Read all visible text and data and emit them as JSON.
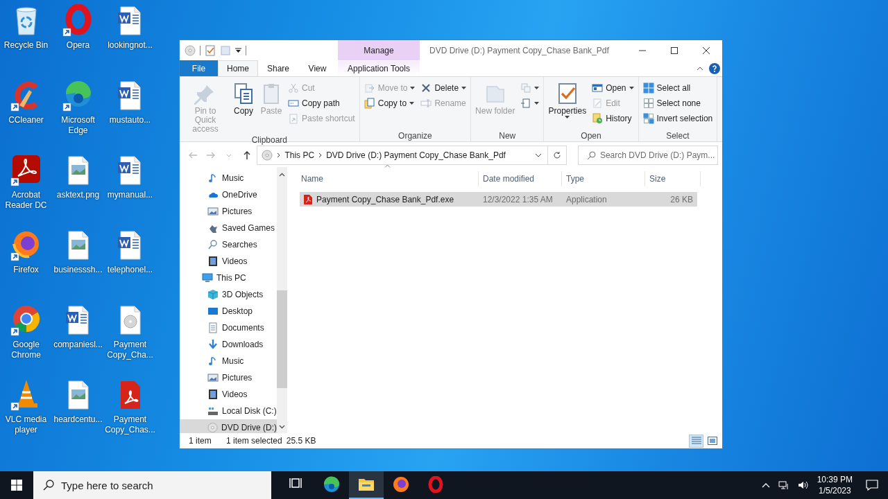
{
  "desktop_icons": [
    {
      "label": "Recycle Bin",
      "kind": "recycle",
      "shortcut": false
    },
    {
      "label": "CCleaner",
      "kind": "ccleaner",
      "shortcut": true
    },
    {
      "label": "Acrobat Reader DC",
      "kind": "acrobat",
      "shortcut": true
    },
    {
      "label": "Firefox",
      "kind": "firefox",
      "shortcut": true
    },
    {
      "label": "Google Chrome",
      "kind": "chrome",
      "shortcut": true
    },
    {
      "label": "VLC media player",
      "kind": "vlc",
      "shortcut": true
    },
    {
      "label": "Opera",
      "kind": "opera",
      "shortcut": true
    },
    {
      "label": "Microsoft Edge",
      "kind": "edge",
      "shortcut": true
    },
    {
      "label": "asktext.png",
      "kind": "image",
      "shortcut": false
    },
    {
      "label": "businesssh...",
      "kind": "image",
      "shortcut": false
    },
    {
      "label": "companiesl...",
      "kind": "word",
      "shortcut": false
    },
    {
      "label": "heardcentu...",
      "kind": "image",
      "shortcut": false
    },
    {
      "label": "lookingnot...",
      "kind": "word",
      "shortcut": false
    },
    {
      "label": "mustauto...",
      "kind": "word",
      "shortcut": false
    },
    {
      "label": "mymanual...",
      "kind": "word",
      "shortcut": false
    },
    {
      "label": "telephonel...",
      "kind": "word",
      "shortcut": false
    },
    {
      "label": "Payment Copy_Cha...",
      "kind": "disc",
      "shortcut": false
    },
    {
      "label": "Payment Copy_Chas...",
      "kind": "pdf",
      "shortcut": false
    }
  ],
  "explorer": {
    "title": "DVD Drive (D:) Payment Copy_Chase Bank_Pdf",
    "context_tab": "Manage",
    "tabs": [
      {
        "label": "File",
        "kind": "file",
        "selected": false
      },
      {
        "label": "Home",
        "kind": "tab",
        "selected": true
      },
      {
        "label": "Share",
        "kind": "tab",
        "selected": false
      },
      {
        "label": "View",
        "kind": "tab",
        "selected": false
      },
      {
        "label": "Application Tools",
        "kind": "context",
        "selected": false
      }
    ],
    "ribbon": [
      {
        "label": "Clipboard",
        "items": [
          {
            "kind": "large",
            "label": "Pin to Quick access",
            "disabled": true
          },
          {
            "kind": "large",
            "label": "Copy",
            "disabled": false
          },
          {
            "kind": "large",
            "label": "Paste",
            "disabled": true
          },
          {
            "kind": "stack",
            "commands": [
              {
                "label": "Cut",
                "disabled": true
              },
              {
                "label": "Copy path",
                "disabled": false
              },
              {
                "label": "Paste shortcut",
                "disabled": true
              }
            ]
          }
        ]
      },
      {
        "label": "Organize",
        "items": [
          {
            "kind": "stack",
            "commands": [
              {
                "label": "Move to",
                "disabled": true,
                "dropdown": true
              },
              {
                "label": "Copy to",
                "disabled": false,
                "dropdown": true
              }
            ]
          },
          {
            "kind": "stack",
            "commands": [
              {
                "label": "Delete",
                "disabled": false,
                "dropdown": true
              },
              {
                "label": "Rename",
                "disabled": true
              }
            ]
          }
        ]
      },
      {
        "label": "New",
        "items": [
          {
            "kind": "large",
            "label": "New folder",
            "disabled": true
          },
          {
            "kind": "stack",
            "commands": [
              {
                "disabled": true,
                "dropdown": true
              },
              {
                "disabled": false,
                "dropdown": true
              }
            ]
          }
        ]
      },
      {
        "label": "Open",
        "items": [
          {
            "kind": "large",
            "label": "Properties",
            "disabled": false,
            "dropdown": true
          },
          {
            "kind": "stack",
            "commands": [
              {
                "label": "Open",
                "disabled": false,
                "dropdown": true
              },
              {
                "label": "Edit",
                "disabled": true
              },
              {
                "label": "History",
                "disabled": false
              }
            ]
          }
        ]
      },
      {
        "label": "Select",
        "items": [
          {
            "kind": "stack",
            "commands": [
              {
                "label": "Select all",
                "disabled": false
              },
              {
                "label": "Select none",
                "disabled": false
              },
              {
                "label": "Invert selection",
                "disabled": false
              }
            ]
          }
        ]
      }
    ],
    "address": {
      "crumbs": [
        "This PC",
        "DVD Drive (D:) Payment Copy_Chase Bank_Pdf"
      ]
    },
    "search": {
      "placeholder": "Search DVD Drive (D:) Paym..."
    },
    "nav_pane": [
      {
        "label": "Music",
        "kind": "music",
        "selected": false
      },
      {
        "label": "OneDrive",
        "kind": "cloud",
        "selected": false
      },
      {
        "label": "Pictures",
        "kind": "pictures",
        "selected": false
      },
      {
        "label": "Saved Games",
        "kind": "games",
        "selected": false
      },
      {
        "label": "Searches",
        "kind": "search",
        "selected": false
      },
      {
        "label": "Videos",
        "kind": "videos",
        "selected": false
      },
      {
        "label": "This PC",
        "kind": "pc",
        "selected": false,
        "children": [
          {
            "label": "3D Objects",
            "kind": "cube",
            "selected": false
          },
          {
            "label": "Desktop",
            "kind": "desktop",
            "selected": false
          },
          {
            "label": "Documents",
            "kind": "documents",
            "selected": false
          },
          {
            "label": "Downloads",
            "kind": "download",
            "selected": false
          },
          {
            "label": "Music",
            "kind": "music",
            "selected": false
          },
          {
            "label": "Pictures",
            "kind": "pictures",
            "selected": false
          },
          {
            "label": "Videos",
            "kind": "videos",
            "selected": false
          },
          {
            "label": "Local Disk (C:)",
            "kind": "disk",
            "selected": false
          },
          {
            "label": "DVD Drive (D:)",
            "kind": "dvd",
            "selected": true
          }
        ]
      }
    ],
    "columns": [
      "Name",
      "Date modified",
      "Type",
      "Size"
    ],
    "files": [
      {
        "name": "Payment Copy_Chase Bank_Pdf.exe",
        "date": "12/3/2022 1:35 AM",
        "type": "Application",
        "size": "26 KB",
        "selected": true
      }
    ],
    "status": {
      "count": "1 item",
      "selection": "1 item selected",
      "size": "25.5 KB"
    },
    "views": [
      {
        "kind": "details",
        "selected": true
      },
      {
        "kind": "large",
        "selected": false
      }
    ]
  },
  "taskbar": {
    "search_placeholder": "Type here to search",
    "apps": [
      {
        "kind": "taskview",
        "active": false
      },
      {
        "kind": "edge",
        "active": false
      },
      {
        "kind": "explorer",
        "active": true
      },
      {
        "kind": "firefox",
        "active": false
      },
      {
        "kind": "opera",
        "active": false
      }
    ],
    "time": "10:39 PM",
    "date": "1/5/2023"
  }
}
